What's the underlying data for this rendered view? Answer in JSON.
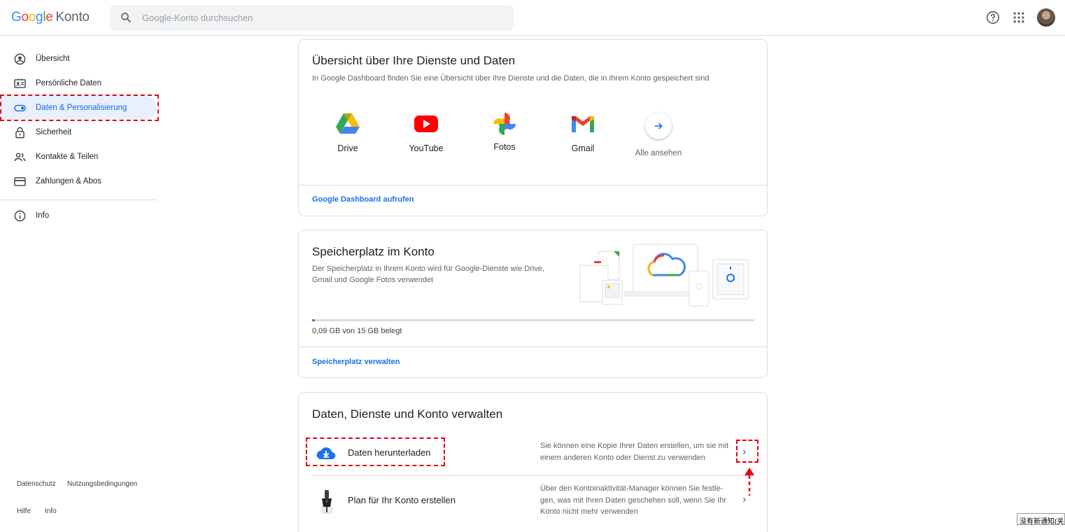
{
  "header": {
    "logo_google": "Google",
    "logo_product": "Konto",
    "search_placeholder": "Google-Konto durchsuchen",
    "icons": [
      "search-icon",
      "help-icon",
      "apps-grid-icon",
      "account-avatar"
    ]
  },
  "sidebar": {
    "items": [
      {
        "label": "Übersicht",
        "icon": "account-circle-icon",
        "active": false
      },
      {
        "label": "Persönliche Daten",
        "icon": "id-card-icon",
        "active": false
      },
      {
        "label": "Daten & Personalisierung",
        "icon": "toggle-icon",
        "active": true
      },
      {
        "label": "Sicherheit",
        "icon": "lock-icon",
        "active": false
      },
      {
        "label": "Kontakte & Teilen",
        "icon": "people-icon",
        "active": false
      },
      {
        "label": "Zahlungen & Abos",
        "icon": "credit-card-icon",
        "active": false
      },
      {
        "label": "Info",
        "icon": "info-icon",
        "active": false
      }
    ],
    "footer": [
      "Datenschutz",
      "Nutzungsbedingungen",
      "Hilfe",
      "Info"
    ]
  },
  "dashboard_card": {
    "title": "Übersicht über Ihre Dienste und Daten",
    "subtitle": "In Google Dashboard finden Sie eine Übersicht über Ihre Dienste und die Daten, die in Ihrem Konto gespeichert sind",
    "services": [
      "Drive",
      "YouTube",
      "Fotos",
      "Gmail"
    ],
    "see_all": "Alle ansehen",
    "link": "Google Dashboard aufrufen"
  },
  "storage_card": {
    "title": "Speicherplatz im Konto",
    "subtitle": "Der Speicherplatz in Ihrem Konto wird für Google-Dienste wie Drive, Gmail und Google Fotos verwendet",
    "usage": "0,09 GB von 15 GB belegt",
    "used_fraction": 0.006,
    "link": "Speicherplatz verwalten"
  },
  "manage_card": {
    "title": "Daten, Dienste und Konto verwalten",
    "rows": [
      {
        "title": "Daten herunterladen",
        "desc": "Sie können eine Kopie Ihrer Daten erstellen, um sie mit einem anderen Konto oder Dienst zu verwenden"
      },
      {
        "title": "Plan für Ihr Konto erstellen",
        "desc": "Über den Kontoinaktivität-Manager können Sie festle-gen, was mit Ihren Daten geschehen soll, wenn Sie Ihr Konto nicht mehr verwenden"
      }
    ]
  },
  "toast": "没有新通知(关闭",
  "colors": {
    "accent": "#1a73e8",
    "active_bg": "#e8f0fe",
    "annotation": "#e3001b"
  }
}
